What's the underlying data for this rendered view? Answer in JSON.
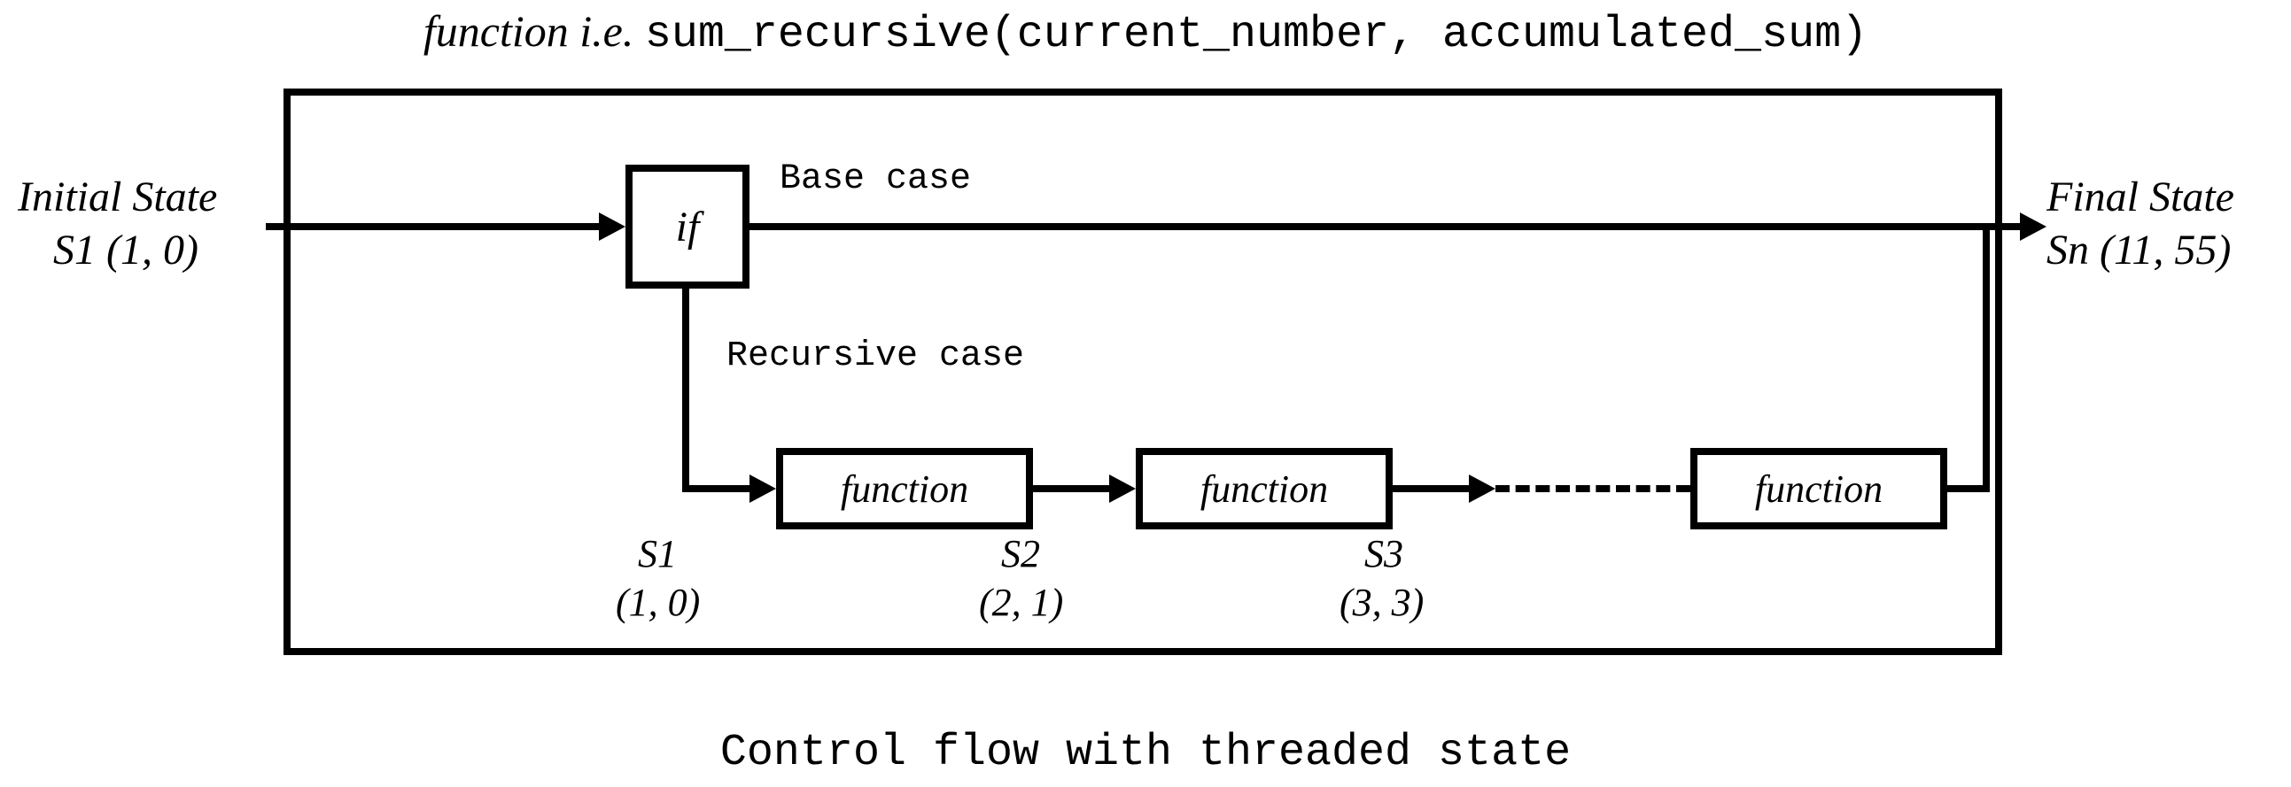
{
  "title": {
    "prefix": "function i.e. ",
    "signature": "sum_recursive(current_number, accumulated_sum)"
  },
  "initial_state": {
    "label_line1": "Initial State",
    "label_line2": "S1 (1, 0)"
  },
  "final_state": {
    "label_line1": "Final State",
    "label_line2": "Sn (11, 55)"
  },
  "if_node": {
    "label": "if"
  },
  "branches": {
    "base_label": "Base case",
    "recursive_label": "Recursive case"
  },
  "func_nodes": {
    "f1": "function",
    "f2": "function",
    "f3": "function"
  },
  "states": {
    "s1": {
      "name": "S1",
      "val": "(1, 0)"
    },
    "s2": {
      "name": "S2",
      "val": "(2, 1)"
    },
    "s3": {
      "name": "S3",
      "val": "(3, 3)"
    }
  },
  "caption": "Control flow with threaded state"
}
